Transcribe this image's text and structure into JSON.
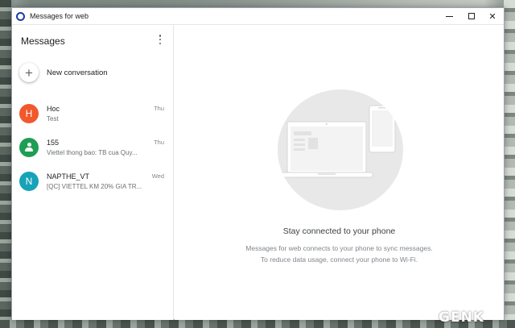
{
  "window": {
    "title": "Messages for web"
  },
  "sidebar": {
    "title": "Messages",
    "new_conversation_label": "New conversation",
    "conversations": [
      {
        "initial": "H",
        "name": "Hoc",
        "snippet": "Test",
        "date": "Thu",
        "avatar_color": "#f1582c",
        "avatar_icon": "letter"
      },
      {
        "initial": "",
        "name": "155",
        "snippet": "Viettel thong bao: TB cua Quy...",
        "date": "Thu",
        "avatar_color": "#1e9e55",
        "avatar_icon": "person-icon"
      },
      {
        "initial": "N",
        "name": "NAPTHE_VT",
        "snippet": "[QC] VIETTEL KM 20% GIA TR...",
        "date": "Wed",
        "avatar_color": "#17a2b8",
        "avatar_icon": "letter"
      }
    ]
  },
  "main": {
    "empty_title": "Stay connected to your phone",
    "empty_line1": "Messages for web connects to your phone to sync messages.",
    "empty_line2": "To reduce data usage, connect your phone to Wi-Fi."
  },
  "watermark": "GENK",
  "colors": {
    "app_icon": "#1a3fa3",
    "illustration_bg": "#e8e8e8"
  }
}
